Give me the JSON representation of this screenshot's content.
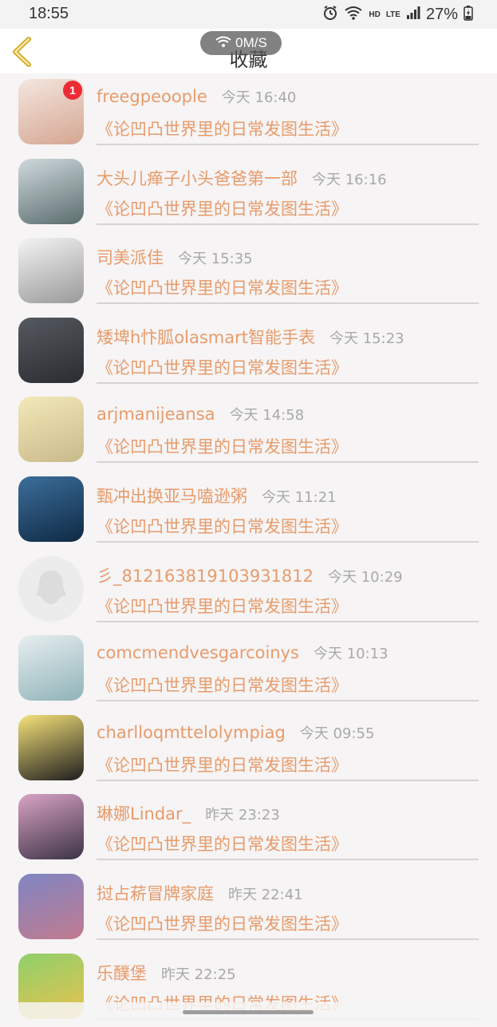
{
  "status_bar": {
    "time": "18:55",
    "network_label": "HD",
    "lte_label": "LTE",
    "battery": "27%"
  },
  "header": {
    "title": "收藏",
    "speed": "0M/S"
  },
  "items": [
    {
      "username": "freegpeoople",
      "time": "今天 16:40",
      "title": "《论凹凸世界里的日常发图生活》",
      "badge": "1",
      "avatar_colors": [
        "#f3e6de",
        "#d5a692"
      ]
    },
    {
      "username": "大头儿瘅子小头爸爸第一部",
      "time": "今天 16:16",
      "title": "《论凹凸世界里的日常发图生活》",
      "badge": "",
      "avatar_colors": [
        "#cfd9dd",
        "#5b6d6e"
      ]
    },
    {
      "username": "司美派佳",
      "time": "今天 15:35",
      "title": "《论凹凸世界里的日常发图生活》",
      "badge": "",
      "avatar_colors": [
        "#f4f4f4",
        "#999999"
      ]
    },
    {
      "username": "矮埤h忭胍olasmart智能手表",
      "time": "今天 15:23",
      "title": "《论凹凸世界里的日常发图生活》",
      "badge": "",
      "avatar_colors": [
        "#555a60",
        "#2a2c31"
      ]
    },
    {
      "username": "arjmanijeansa",
      "time": "今天 14:58",
      "title": "《论凹凸世界里的日常发图生活》",
      "badge": "",
      "avatar_colors": [
        "#f3e9b8",
        "#c9b98a"
      ]
    },
    {
      "username": "甄冲出换亚马嗑逊粥",
      "time": "今天 11:21",
      "title": "《论凹凸世界里的日常发图生活》",
      "badge": "",
      "avatar_colors": [
        "#3c6e9a",
        "#0f2a45"
      ]
    },
    {
      "username": "彡_812163819103931812",
      "time": "今天 10:29",
      "title": "《论凹凸世界里的日常发图生活》",
      "badge": "",
      "avatar_colors": [
        "#ececec",
        "#dddddd"
      ],
      "default_avatar": true
    },
    {
      "username": "comcmendvesgarcoinys",
      "time": "今天 10:13",
      "title": "《论凹凸世界里的日常发图生活》",
      "badge": "",
      "avatar_colors": [
        "#e8eef0",
        "#8fb3b8"
      ]
    },
    {
      "username": "charlloqmttelolympiag",
      "time": "今天 09:55",
      "title": "《论凹凸世界里的日常发图生活》",
      "badge": "",
      "avatar_colors": [
        "#f6e27a",
        "#1e1e1e"
      ]
    },
    {
      "username": "琳娜Lindar_",
      "time": "昨天 23:23",
      "title": "《论凹凸世界里的日常发图生活》",
      "badge": "",
      "avatar_colors": [
        "#d9a3c5",
        "#3b3246"
      ]
    },
    {
      "username": "挝占菥冒牌家庭",
      "time": "昨天 22:41",
      "title": "《论凹凸世界里的日常发图生活》",
      "badge": "",
      "avatar_colors": [
        "#7f86c4",
        "#c17a8f"
      ]
    },
    {
      "username": "乐醭堡",
      "time": "昨天 22:25",
      "title": "《论凹凸世界里的日常发图生活》",
      "badge": "",
      "avatar_colors": [
        "#8fd06a",
        "#e9c24f"
      ]
    }
  ],
  "colors": {
    "accent": "#e89b6a",
    "time_gray": "#a9a9a9",
    "background": "#f6f4f5",
    "badge_red": "#ee2b35",
    "back_arrow": "#d8ac2d"
  },
  "icons": {
    "back": "chevron-left-icon",
    "alarm": "alarm-icon",
    "wifi": "wifi-icon",
    "signal": "signal-icon",
    "battery": "battery-icon"
  }
}
